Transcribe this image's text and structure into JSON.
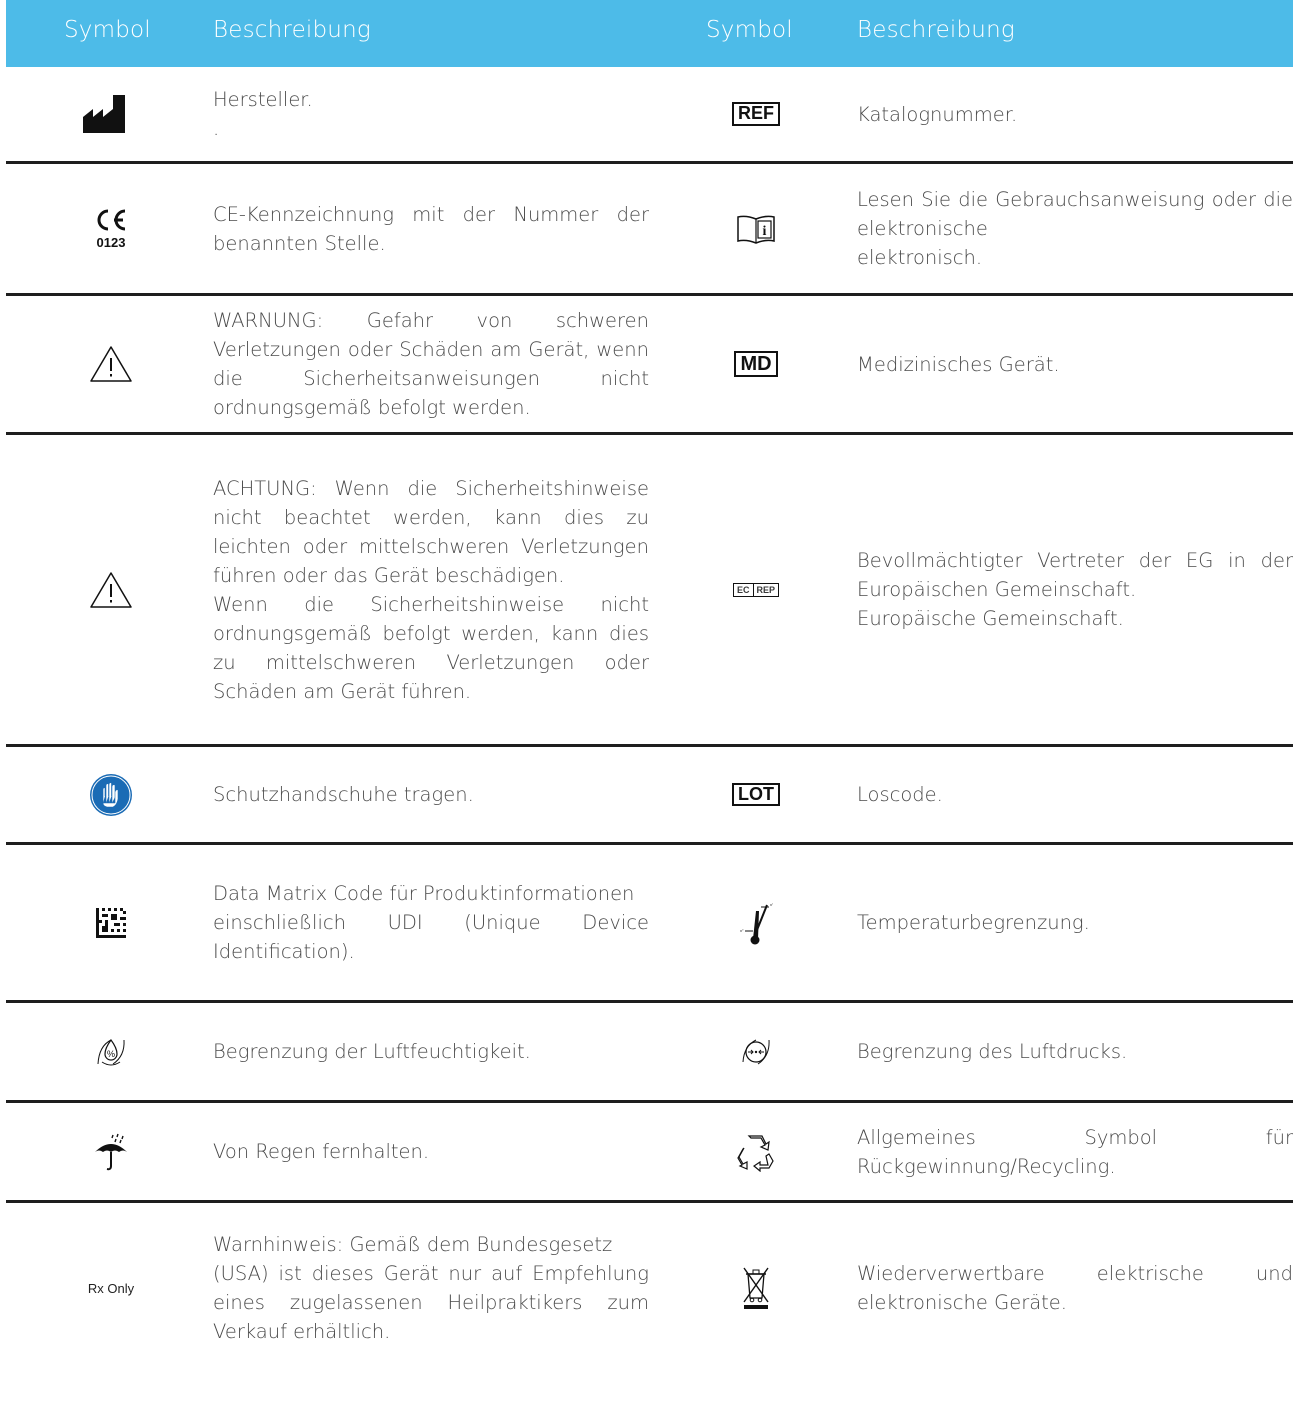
{
  "header": {
    "symbol_left": "Symbol",
    "desc_left": "Beschreibung",
    "symbol_right": "Symbol",
    "desc_right": "Beschreibung"
  },
  "rows": [
    {
      "left_icon": "manufacturer-icon",
      "left_text": "Hersteller.\n.",
      "right_icon": "ref-icon",
      "right_label": "REF",
      "right_text": "Katalognummer."
    },
    {
      "left_icon": "ce-mark-icon",
      "left_label": "0123",
      "left_text": "CE-Kennzeichnung mit der Nummer der benannten Stelle.",
      "right_icon": "instructions-icon",
      "right_text": "Lesen Sie die Gebrauchsanweisung oder die elektronische\nelektronisch."
    },
    {
      "left_icon": "warning-icon",
      "left_text": "WARNUNG: Gefahr von schweren Verletzungen oder Schäden am Gerät, wenn die Sicherheitsanweisungen nicht ordnungsgemäß befolgt werden.",
      "right_icon": "md-icon",
      "right_label": "MD",
      "right_text": "Medizinisches Gerät."
    },
    {
      "left_icon": "caution-icon",
      "left_text": "ACHTUNG: Wenn die Sicherheitshinweise nicht beachtet werden, kann dies zu leichten oder mittelschweren Verletzungen führen oder das Gerät beschädigen.\nWenn die Sicherheitshinweise nicht ordnungsgemäß befolgt werden, kann dies zu mittelschweren Verletzungen oder Schäden am Gerät führen.",
      "right_icon": "ec-rep-icon",
      "right_label_a": "EC",
      "right_label_b": "REP",
      "right_text": "Bevollmächtigter Vertreter der EG in der Europäischen Gemeinschaft.\nEuropäische Gemeinschaft."
    },
    {
      "left_icon": "gloves-icon",
      "left_text": "Schutzhandschuhe tragen.",
      "right_icon": "lot-icon",
      "right_label": "LOT",
      "right_text": "Loscode."
    },
    {
      "left_icon": "data-matrix-icon",
      "left_text": "Data Matrix Code für Produktinformationen\neinschließlich UDI (Unique Device Identification).",
      "right_icon": "temperature-limit-icon",
      "right_text": "Temperaturbegrenzung."
    },
    {
      "left_icon": "humidity-limit-icon",
      "left_text": "Begrenzung der Luftfeuchtigkeit.",
      "right_icon": "pressure-limit-icon",
      "right_text": "Begrenzung des Luftdrucks."
    },
    {
      "left_icon": "keep-dry-icon",
      "left_text": "Von Regen fernhalten.",
      "right_icon": "recycling-icon",
      "right_text": "Allgemeines Symbol für Rückgewinnung/Recycling."
    },
    {
      "left_icon": "rx-only-icon",
      "left_label": "Rx Only",
      "left_text": "Warnhinweis: Gemäß dem Bundesgesetz\n(USA) ist dieses Gerät nur auf Empfehlung eines zugelassenen Heilpraktikers zum Verkauf erhältlich.",
      "right_icon": "weee-icon",
      "right_text": "Wiederverwertbare elektrische und elektronische Geräte."
    }
  ]
}
